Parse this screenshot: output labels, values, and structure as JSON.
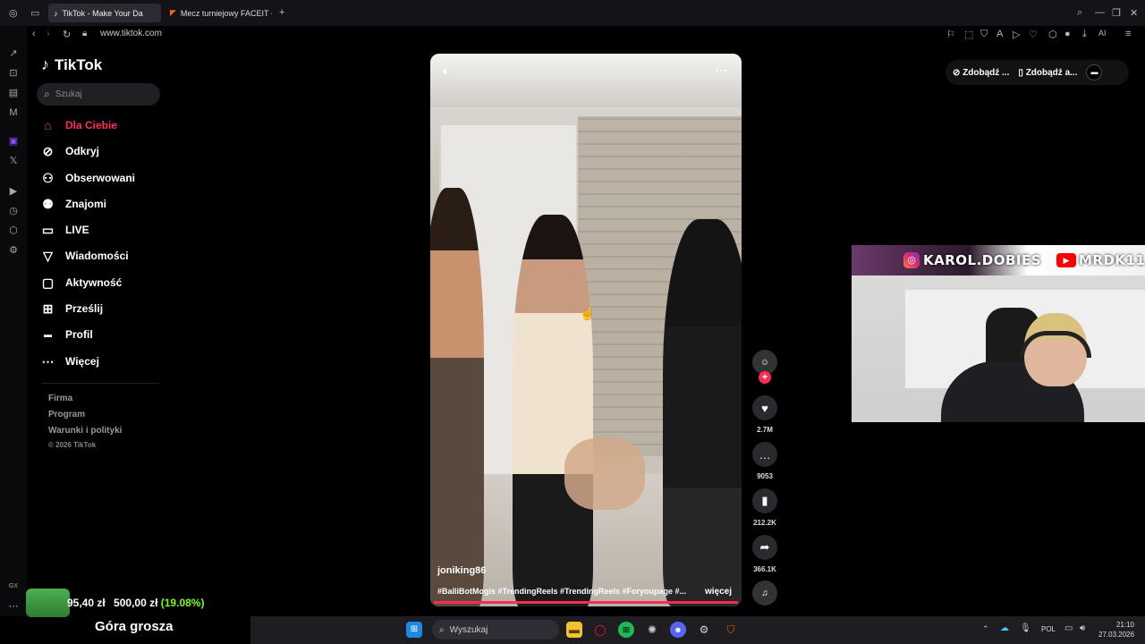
{
  "browser": {
    "tabs": [
      {
        "label": "TikTok - Make Your Da",
        "active": true
      },
      {
        "label": "Mecz turniejowy FACEIT -",
        "active": false
      }
    ],
    "url": "www.tiktok.com",
    "ai_label": "AI"
  },
  "tiktok": {
    "logo_text": "TikTok",
    "search_placeholder": "Szukaj",
    "nav": [
      {
        "label": "Dla Ciebie",
        "icon": "home-icon",
        "active": true
      },
      {
        "label": "Odkryj",
        "icon": "compass-icon"
      },
      {
        "label": "Obserwowani",
        "icon": "following-icon"
      },
      {
        "label": "Znajomi",
        "icon": "friends-icon"
      },
      {
        "label": "LIVE",
        "icon": "live-icon"
      },
      {
        "label": "Wiadomości",
        "icon": "send-icon"
      },
      {
        "label": "Aktywność",
        "icon": "inbox-icon"
      },
      {
        "label": "Prześlij",
        "icon": "upload-icon"
      },
      {
        "label": "Profil",
        "icon": "profile-icon"
      },
      {
        "label": "Więcej",
        "icon": "more-icon"
      }
    ],
    "footer": [
      "Firma",
      "Program",
      "Warunki i polityki",
      "© 2026 TikTok"
    ],
    "top_right": {
      "get_coins": "Zdobądź ...",
      "get_app": "Zdobądź a..."
    },
    "video": {
      "username": "joniking86",
      "hashtags": "#BalliBotMogis #TrendingReels #TrendingReels #Foryoupage #...",
      "more": "więcej"
    },
    "actions": {
      "likes": "2.7M",
      "comments": "9053",
      "saves": "212.2K",
      "shares": "366.1K"
    }
  },
  "stream_overlay": {
    "instagram": "KAROL.DOBIES",
    "youtube": "MRDK11",
    "money_current": "95,40 zł",
    "money_goal": "500,00 zł",
    "money_percent": "(19.08%)",
    "goal_progress": 0.1908,
    "goal_title": "Góra grosza"
  },
  "taskbar": {
    "search_placeholder": "Wyszukaj",
    "language": "POL",
    "time": "21:10",
    "date": "27.03.2026"
  },
  "colors": {
    "accent": "#fe2c55",
    "money_green": "#4caf50",
    "percent_green": "#7cfc00"
  }
}
